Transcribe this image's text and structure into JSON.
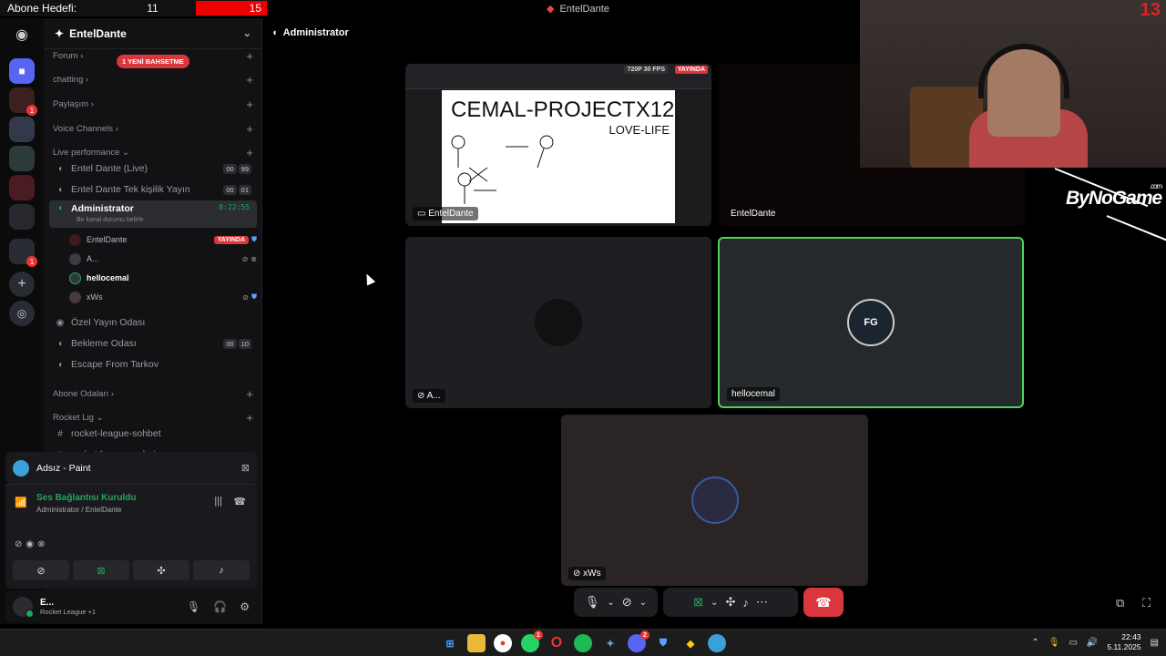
{
  "overlay": {
    "abone_label": "Abone Hedefi:",
    "abone_current": "11",
    "abone_target": "15",
    "window_title": "EntelDante",
    "webcam_counter": "13",
    "bynogame": "ByNoGame",
    "bynogame_com": ".com"
  },
  "server": {
    "name": "EntelDante",
    "mention_badge": "1 YENİ BAHSETME"
  },
  "categories": {
    "forum": "Forum",
    "chatting": "chatting",
    "paylasim": "Paylaşım",
    "voice": "Voice Channels",
    "live": "Live performance",
    "abone": "Abone Odaları",
    "rocket": "Rocket Lig"
  },
  "channels": {
    "entel_live": {
      "name": "Entel Dante (Live)",
      "c1": "00",
      "c2": "99"
    },
    "entel_tek": {
      "name": "Entel Dante Tek kişilik Yayın",
      "c1": "00",
      "c2": "01"
    },
    "admin": {
      "name": "Administrator",
      "sub": "Bir kanal durumu belirle",
      "time": "8:22:55"
    },
    "ozel": {
      "name": "Özel Yayın Odası"
    },
    "bekleme": {
      "name": "Bekleme Odası",
      "c1": "00",
      "c2": "10"
    },
    "tarkov": {
      "name": "Escape From Tarkov"
    },
    "rl_sohbet": {
      "name": "rocket-league-sohbet"
    },
    "rl_galeri": {
      "name": "rocket-league-galeri"
    }
  },
  "voice_users": [
    {
      "name": "EntelDante",
      "badge": "YAYINDA"
    },
    {
      "name": "A..."
    },
    {
      "name": "hellocemal"
    },
    {
      "name": "xWs"
    }
  ],
  "activity": {
    "title": "Adsız - Paint"
  },
  "connection": {
    "status": "Ses Bağlantısı Kuruldu",
    "sub": "Administrator / EntelDante"
  },
  "user": {
    "name": "E...",
    "status": "Rocket League +1"
  },
  "main": {
    "channel": "Administrator"
  },
  "tiles": {
    "stream": {
      "label": "EntelDante",
      "fps": "720P 30 FPS",
      "live": "YAYINDA",
      "paint_title": "CEMAL-PROJECTX12",
      "paint_sub": "LOVE-LIFE"
    },
    "t2": {
      "label": "EntelDante"
    },
    "t3": {
      "label": "A..."
    },
    "t4": {
      "label": "hellocemal"
    },
    "t5": {
      "label": "xWs"
    }
  },
  "taskbar": {
    "time": "22:43",
    "date": "5.11.2025"
  },
  "colors": {
    "live_red": "#da373c",
    "voice_green": "#23a55a",
    "speaking_border": "#4fd35b"
  }
}
